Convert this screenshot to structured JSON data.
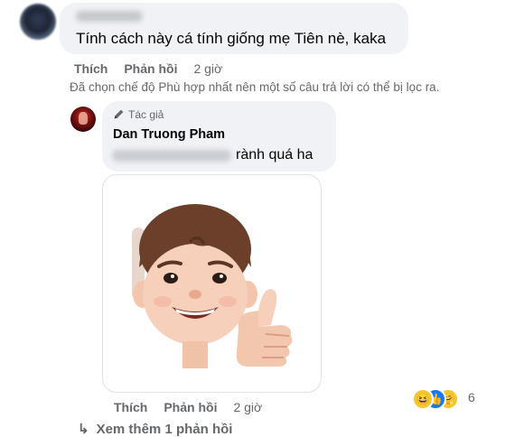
{
  "comment1": {
    "text": "Tính cách này cá tính giống mẹ Tiên nè, kaka",
    "actions": {
      "like_label": "Thích",
      "reply_label": "Phản hồi",
      "time": "2 giờ"
    },
    "filter_note": "Đã chọn chế độ Phù hợp nhất nên một số câu trả lời có thể bị lọc ra."
  },
  "reply": {
    "author_badge": "Tác giả",
    "author_name": "Dan Truong Pham",
    "text": "rành quá ha",
    "sticker_icon": "memoji-thumbs-up",
    "actions": {
      "like_label": "Thích",
      "reply_label": "Phản hồi",
      "time": "2 giờ"
    },
    "reactions": {
      "icons": [
        "haha-icon",
        "like-icon",
        "care-icon"
      ],
      "count": "6"
    }
  },
  "more_replies": {
    "arrow_icon": "reply-arrow-icon",
    "label": "Xem thêm 1 phản hồi"
  },
  "colors": {
    "bubble": "#f0f2f5",
    "secondary_text": "#65676b",
    "like_blue": "#1877f2"
  }
}
